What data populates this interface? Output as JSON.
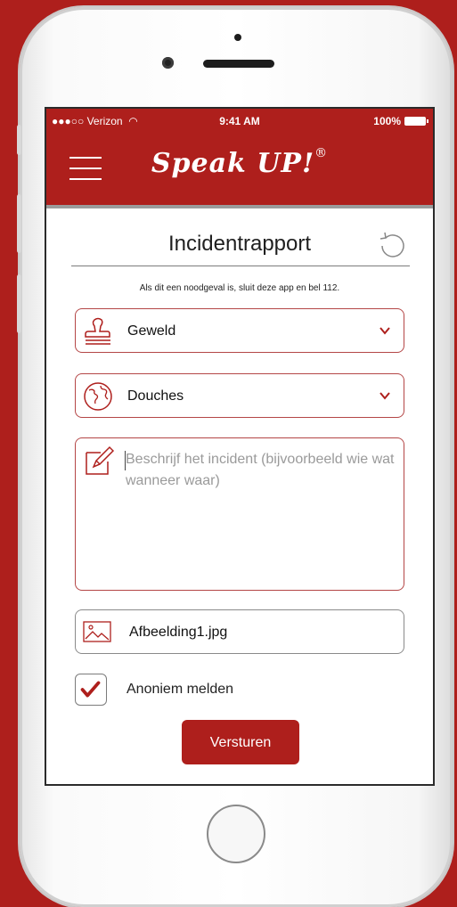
{
  "status_bar": {
    "carrier": "●●●○○ Verizon",
    "time": "9:41 AM",
    "battery": "100%"
  },
  "app": {
    "brand": "Speak UP!",
    "brand_mark": "®"
  },
  "form": {
    "title": "Incidentrapport",
    "notice": "Als dit een noodgeval is, sluit deze app en bel 112.",
    "category_value": "Geweld",
    "location_value": "Douches",
    "description_placeholder": "Beschrijf het incident (bijvoorbeeld wie wat wanneer waar)",
    "attachment_filename": "Afbeelding1.jpg",
    "anonymous_label": "Anoniem melden",
    "anonymous_checked": true,
    "submit_label": "Versturen"
  },
  "colors": {
    "brand_red": "#ae1f1c",
    "field_border": "#b44646"
  },
  "icons": {
    "category": "stamp-icon",
    "location": "globe-icon",
    "description": "pencil-note-icon",
    "attachment": "image-icon",
    "refresh": "refresh-icon",
    "dropdown": "chevron-down-icon"
  }
}
